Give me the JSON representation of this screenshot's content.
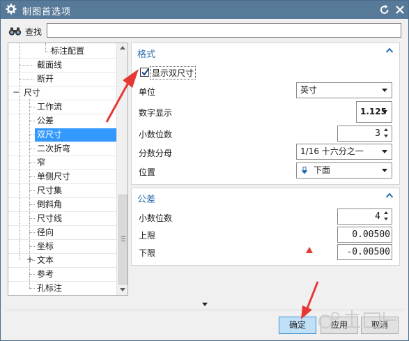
{
  "window": {
    "title": "制图首选项"
  },
  "search": {
    "label": "查找",
    "value": ""
  },
  "tree": {
    "items": [
      {
        "label": "标注配置",
        "selected": false
      },
      {
        "label": "截面线",
        "selected": false
      },
      {
        "label": "断开",
        "selected": false
      },
      {
        "label": "尺寸",
        "selected": false,
        "expander": "−"
      },
      {
        "label": "工作流",
        "selected": false
      },
      {
        "label": "公差",
        "selected": false
      },
      {
        "label": "双尺寸",
        "selected": true
      },
      {
        "label": "二次折弯",
        "selected": false
      },
      {
        "label": "窄",
        "selected": false
      },
      {
        "label": "单侧尺寸",
        "selected": false
      },
      {
        "label": "尺寸集",
        "selected": false
      },
      {
        "label": "倒斜角",
        "selected": false
      },
      {
        "label": "尺寸线",
        "selected": false
      },
      {
        "label": "径向",
        "selected": false
      },
      {
        "label": "坐标",
        "selected": false
      },
      {
        "label": "文本",
        "selected": false,
        "expander": "+"
      },
      {
        "label": "参考",
        "selected": false
      },
      {
        "label": "孔标注",
        "selected": false
      }
    ]
  },
  "format_panel": {
    "title": "格式",
    "show_dual_label": "显示双尺寸",
    "show_dual_checked": true,
    "unit_label": "单位",
    "unit_value": "英寸",
    "numeric_display_label": "数字显示",
    "numeric_display_value": "1.125",
    "decimal_places_label": "小数位数",
    "decimal_places_value": "3",
    "fraction_denominator_label": "分数分母",
    "fraction_denominator_value": "1/16 十六分之一",
    "position_label": "位置",
    "position_value": "下面"
  },
  "tolerance_panel": {
    "title": "公差",
    "decimal_places_label": "小数位数",
    "decimal_places_value": "4",
    "upper_label": "上限",
    "upper_value": "0.00500",
    "lower_label": "下限",
    "lower_value": "-0.00500"
  },
  "buttons": {
    "ok": "确定",
    "apply": "应用",
    "cancel": "取消"
  },
  "colors": {
    "titlebar": "#587a99",
    "selection": "#3399ff",
    "section_title": "#2b6cb0",
    "annotation_arrow": "#e53935"
  }
}
